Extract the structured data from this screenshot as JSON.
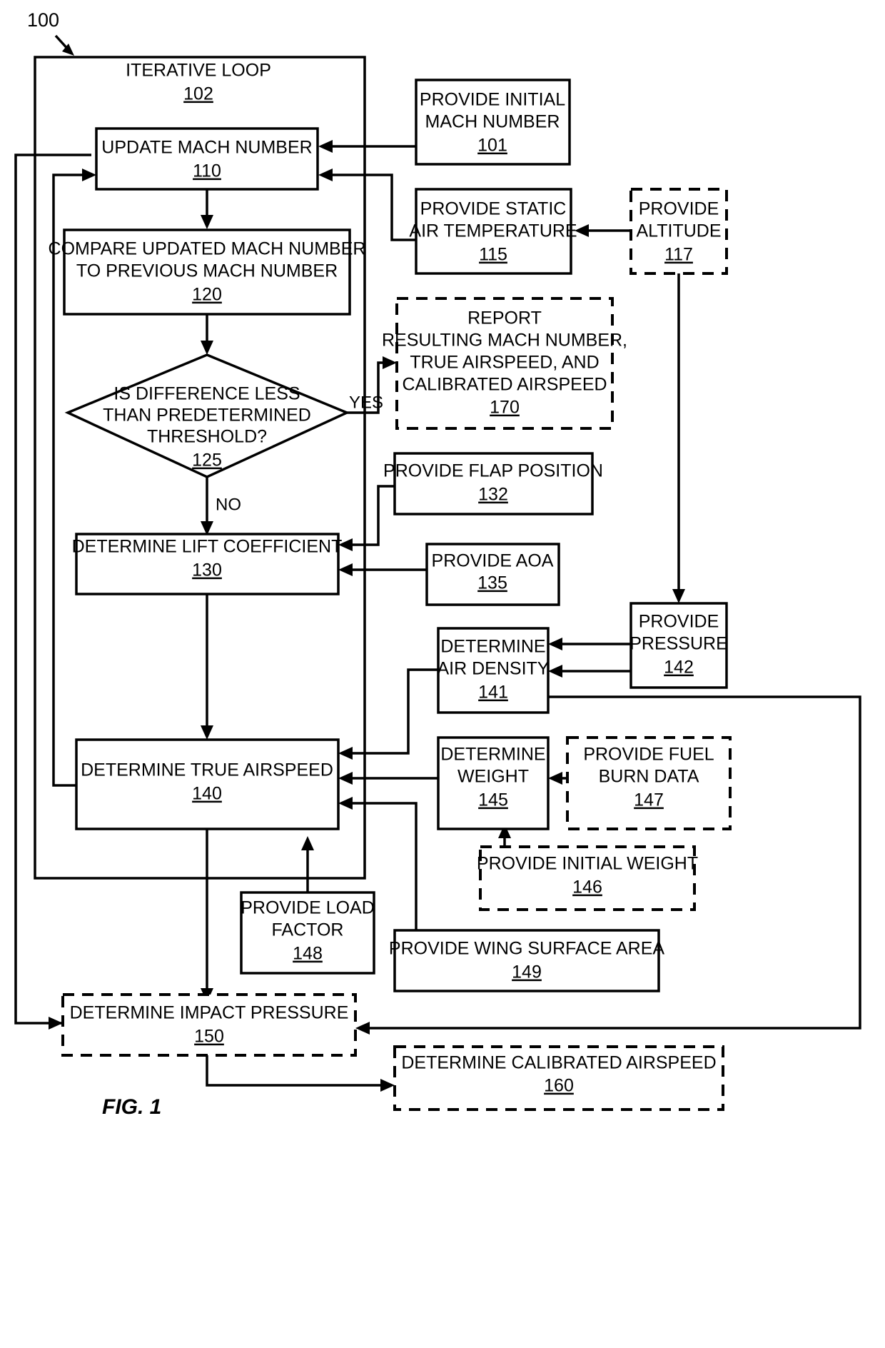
{
  "figure": {
    "label": "FIG. 1",
    "callout": "100"
  },
  "container": {
    "title": "ITERATIVE LOOP",
    "ref": "102"
  },
  "nodes": {
    "update_mach": {
      "lines": [
        "UPDATE MACH NUMBER"
      ],
      "ref": "110",
      "style": "solid"
    },
    "provide_initial_mach": {
      "lines": [
        "PROVIDE INITIAL",
        "MACH NUMBER"
      ],
      "ref": "101",
      "style": "solid"
    },
    "compare_mach": {
      "lines": [
        "COMPARE UPDATED MACH NUMBER",
        "TO PREVIOUS MACH NUMBER"
      ],
      "ref": "120",
      "style": "solid"
    },
    "provide_static_air_temp": {
      "lines": [
        "PROVIDE STATIC",
        "AIR TEMPERATURE"
      ],
      "ref": "115",
      "style": "solid"
    },
    "provide_altitude": {
      "lines": [
        "PROVIDE",
        "ALTITUDE"
      ],
      "ref": "117",
      "style": "dashed"
    },
    "decision": {
      "lines": [
        "IS DIFFERENCE LESS",
        "THAN PREDETERMINED",
        "THRESHOLD?"
      ],
      "ref": "125",
      "style": "diamond"
    },
    "report": {
      "lines": [
        "REPORT",
        "RESULTING MACH NUMBER,",
        "TRUE AIRSPEED, AND",
        "CALIBRATED AIRSPEED"
      ],
      "ref": "170",
      "style": "dashed"
    },
    "provide_flap_position": {
      "lines": [
        "PROVIDE FLAP POSITION"
      ],
      "ref": "132",
      "style": "solid"
    },
    "determine_lift_coefficient": {
      "lines": [
        "DETERMINE LIFT COEFFICIENT"
      ],
      "ref": "130",
      "style": "solid"
    },
    "provide_aoa": {
      "lines": [
        "PROVIDE AOA"
      ],
      "ref": "135",
      "style": "solid"
    },
    "provide_pressure": {
      "lines": [
        "PROVIDE",
        "PRESSURE"
      ],
      "ref": "142",
      "style": "solid"
    },
    "determine_air_density": {
      "lines": [
        "DETERMINE",
        "AIR DENSITY"
      ],
      "ref": "141",
      "style": "solid"
    },
    "determine_true_airspeed": {
      "lines": [
        "DETERMINE TRUE AIRSPEED"
      ],
      "ref": "140",
      "style": "solid"
    },
    "determine_weight": {
      "lines": [
        "DETERMINE",
        "WEIGHT"
      ],
      "ref": "145",
      "style": "solid"
    },
    "provide_fuel_burn_data": {
      "lines": [
        "PROVIDE FUEL",
        "BURN DATA"
      ],
      "ref": "147",
      "style": "dashed"
    },
    "provide_initial_weight": {
      "lines": [
        "PROVIDE INITIAL WEIGHT"
      ],
      "ref": "146",
      "style": "dashed"
    },
    "provide_load_factor": {
      "lines": [
        "PROVIDE LOAD",
        "FACTOR"
      ],
      "ref": "148",
      "style": "solid"
    },
    "provide_wing_surface_area": {
      "lines": [
        "PROVIDE WING SURFACE AREA"
      ],
      "ref": "149",
      "style": "solid"
    },
    "determine_impact_pressure": {
      "lines": [
        "DETERMINE IMPACT PRESSURE"
      ],
      "ref": "150",
      "style": "dashed"
    },
    "determine_calibrated_airspeed": {
      "lines": [
        "DETERMINE CALIBRATED AIRSPEED"
      ],
      "ref": "160",
      "style": "dashed"
    }
  },
  "edge_labels": {
    "yes": "YES",
    "no": "NO"
  },
  "colors": {
    "stroke": "#000000",
    "background": "#ffffff"
  }
}
